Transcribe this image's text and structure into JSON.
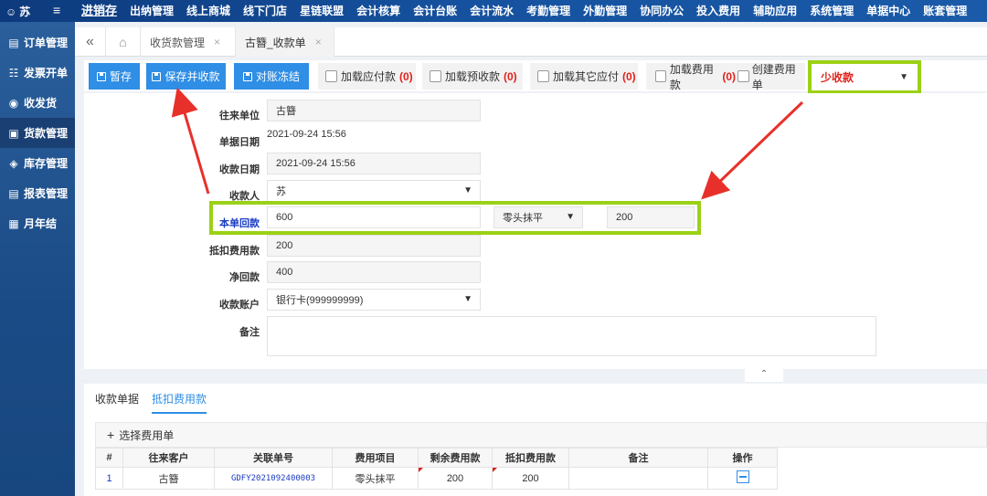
{
  "topbar": {
    "user": "苏",
    "menu_icon": "hamburger-icon",
    "nav": [
      "进销存",
      "出纳管理",
      "线上商城",
      "线下门店",
      "星链联盟",
      "会计核算",
      "会计台账",
      "会计流水",
      "考勤管理",
      "外勤管理",
      "协同办公",
      "投入费用",
      "辅助应用",
      "系统管理",
      "单据中心",
      "账套管理"
    ]
  },
  "sidebar": {
    "items": [
      {
        "label": "订单管理",
        "icon": "order-icon"
      },
      {
        "label": "发票开单",
        "icon": "invoice-icon"
      },
      {
        "label": "收发货",
        "icon": "shipping-icon"
      },
      {
        "label": "货款管理",
        "icon": "payment-icon"
      },
      {
        "label": "库存管理",
        "icon": "inventory-icon"
      },
      {
        "label": "报表管理",
        "icon": "report-icon"
      },
      {
        "label": "月年结",
        "icon": "calendar-icon"
      }
    ]
  },
  "tabs": [
    {
      "label": "收货款管理"
    },
    {
      "label": "古簪_收款单"
    }
  ],
  "toolbar": {
    "save_draft": "暂存",
    "save_collect": "保存并收款",
    "reconcile": "对账冻结",
    "load_payable": "加载应付款",
    "load_payable_count": "(0)",
    "load_prepaid": "加载预收款",
    "load_prepaid_count": "(0)",
    "load_other": "加载其它应付",
    "load_other_count": "(0)",
    "load_fee": "加载费用款",
    "load_fee_count": "(0)",
    "create_fee": "创建费用单",
    "collect_mode": "少收款"
  },
  "form": {
    "partner_label": "往来单位",
    "partner_value": "古簪",
    "doc_date_label": "单据日期",
    "doc_date_value": "2021-09-24 15:56",
    "collect_date_label": "收款日期",
    "collect_date_value": "2021-09-24 15:56",
    "collector_label": "收款人",
    "collector_value": "苏",
    "this_return_label": "本单回款",
    "this_return_value": "600",
    "rounding_option": "零头抹平",
    "rounding_value": "200",
    "deduct_label": "抵扣费用款",
    "deduct_value": "200",
    "net_label": "净回款",
    "net_value": "400",
    "account_label": "收款账户",
    "account_value": "银行卡(999999999)",
    "note_label": "备注",
    "note_value": ""
  },
  "subtabs": [
    "收款单据",
    "抵扣费用款"
  ],
  "sub": {
    "select_label": "选择费用单"
  },
  "table": {
    "headers": [
      "#",
      "往来客户",
      "关联单号",
      "费用项目",
      "剩余费用款",
      "抵扣费用款",
      "备注",
      "操作"
    ],
    "rows": [
      [
        "1",
        "古簪",
        "GDFY2021092400003",
        "零头抹平",
        "200",
        "200",
        ""
      ]
    ]
  },
  "colors": {
    "accent": "#2f8ee5",
    "highlight": "#9bd116",
    "warning": "#e0221b",
    "nav_bg": "#15519e"
  }
}
